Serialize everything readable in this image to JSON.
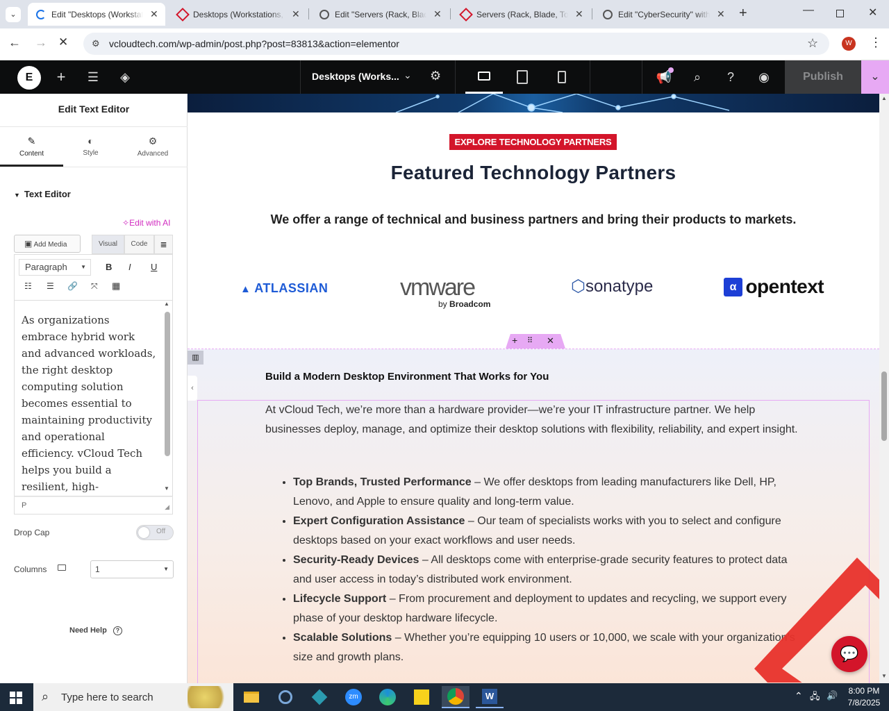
{
  "browser": {
    "tabs": [
      {
        "title": "Edit \"Desktops (Workstati",
        "active": true
      },
      {
        "title": "Desktops (Workstations, ",
        "active": false
      },
      {
        "title": "Edit \"Servers (Rack, Blade",
        "active": false
      },
      {
        "title": "Servers (Rack, Blade, Tow",
        "active": false
      },
      {
        "title": "Edit \"CyberSecurity\" with",
        "active": false
      }
    ],
    "url": "vcloudtech.com/wp-admin/post.php?post=83813&action=elementor",
    "profile_initial": "W"
  },
  "elementor_bar": {
    "page_title": "Desktops (Works...",
    "publish_label": "Publish"
  },
  "panel": {
    "title": "Edit Text Editor",
    "tabs": [
      {
        "label": "Content",
        "icon": "pencil-icon"
      },
      {
        "label": "Style",
        "icon": "half-circle-icon"
      },
      {
        "label": "Advanced",
        "icon": "gear-icon"
      }
    ],
    "section_title": "Text Editor",
    "edit_ai": "Edit with AI",
    "add_media": "Add Media",
    "visual_tab": "Visual",
    "code_tab": "Code",
    "format_select": "Paragraph",
    "editor_text": "As organizations embrace hybrid work and advanced workloads, the right desktop computing solution becomes essential to maintaining productivity and operational efficiency. vCloud Tech helps you build a resilient, high-performance workspace",
    "path_label": "P",
    "drop_cap_label": "Drop Cap",
    "drop_cap_value": "Off",
    "columns_label": "Columns",
    "columns_value": "1",
    "need_help": "Need Help"
  },
  "canvas": {
    "badge": "EXPLORE TECHNOLOGY PARTNERS",
    "heading": "Featured Technology Partners",
    "subheading": "We offer a range of technical and business partners and bring their products to markets.",
    "logos": {
      "atlassian": "ATLASSIAN",
      "vmware": "vmware",
      "vmware_by": "by",
      "vmware_broadcom": "Broadcom",
      "sonatype": "sonatype",
      "opentext": "opentext"
    },
    "section_heading": "Build a Modern Desktop Environment That Works for You",
    "intro": "At vCloud Tech, we’re more than a hardware provider—we’re your IT infrastructure partner. We help businesses deploy, manage, and optimize their desktop solutions with flexibility, reliability, and expert insight.",
    "bullets": [
      {
        "bold": "Top Brands, Trusted Performance",
        "text": " – We offer desktops from leading manufacturers like Dell, HP, Lenovo, and Apple to ensure quality and long-term value."
      },
      {
        "bold": "Expert Configuration Assistance",
        "text": " – Our team of specialists works with you to select and configure desktops based on your exact workflows and user needs."
      },
      {
        "bold": "Security-Ready Devices",
        "text": " – All desktops come with enterprise-grade security features to protect data and user access in today’s distributed work environment."
      },
      {
        "bold": "Lifecycle Support",
        "text": " – From procurement and deployment to updates and recycling, we support every phase of your desktop hardware lifecycle."
      },
      {
        "bold": "Scalable Solutions",
        "text": " – Whether you’re equipping 10 users or 10,000, we scale with your organization’s size and growth plans."
      }
    ]
  },
  "taskbar": {
    "search_placeholder": "Type here to search",
    "time": "8:00 PM",
    "date": "7/8/2025"
  },
  "colors": {
    "elementor_pink": "#d12cc0",
    "badge_red": "#d3152a",
    "heading_navy": "#1b2437",
    "publish_bg": "#3a3b3d",
    "dropdown_pink": "#e7a9f4"
  }
}
